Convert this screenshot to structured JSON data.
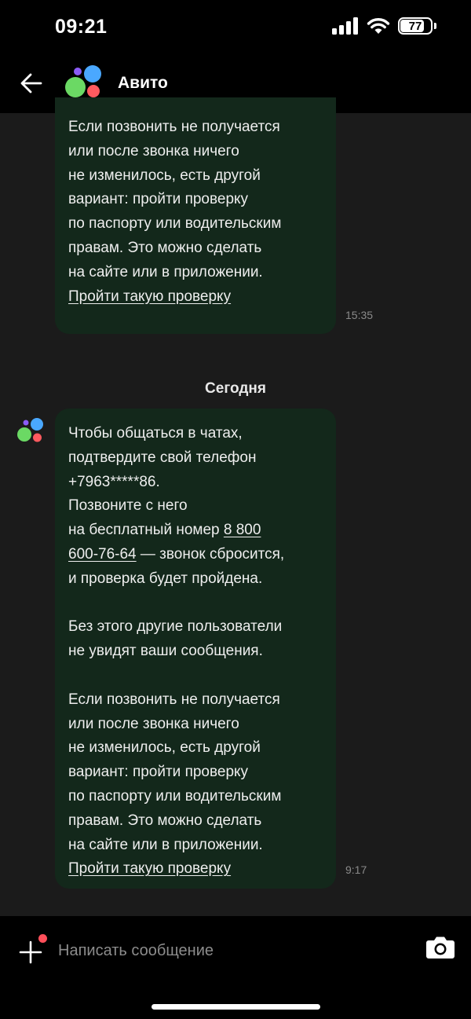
{
  "status_bar": {
    "time": "09:21",
    "battery": "77"
  },
  "header": {
    "title": "Авито"
  },
  "colors": {
    "bubble": "#13281b",
    "logo_blue": "#4aa8ff",
    "logo_green": "#6bd964",
    "logo_red": "#ff5a5f",
    "attach_dot": "#ff4f5a"
  },
  "messages": [
    {
      "time": "15:35",
      "lines": [
        "Если позвонить не получается",
        "или после звонка ничего",
        "не изменилось, есть другой",
        "вариант: пройти проверку",
        "по паспорту или водительским",
        "правам. Это можно сделать",
        "на сайте или в приложении."
      ],
      "link": "Пройти такую проверку"
    },
    {
      "time": "9:17",
      "p1": [
        "Чтобы общаться в чатах,",
        "подтвердите свой телефон",
        "+7963*****86.",
        "Позвоните с него"
      ],
      "number_prefix": "на бесплатный номер ",
      "number_part1": "8 800",
      "number_part2": "600-76-64",
      "number_suffix": " — звонок сбросится,",
      "p1_end": "и проверка будет пройдена.",
      "p2": [
        "Без этого другие пользователи",
        "не увидят ваши сообщения."
      ],
      "p3": [
        "Если позвонить не получается",
        "или после звонка ничего",
        "не изменилось, есть другой",
        "вариант: пройти проверку",
        "по паспорту или водительским",
        "правам. Это можно сделать",
        "на сайте или в приложении."
      ],
      "link": "Пройти такую проверку"
    }
  ],
  "date_separator": "Сегодня",
  "composer": {
    "placeholder": "Написать сообщение"
  },
  "icons": {
    "back": "arrow-left-icon",
    "attach": "plus-icon",
    "camera": "camera-icon",
    "logo": "avito-logo"
  }
}
